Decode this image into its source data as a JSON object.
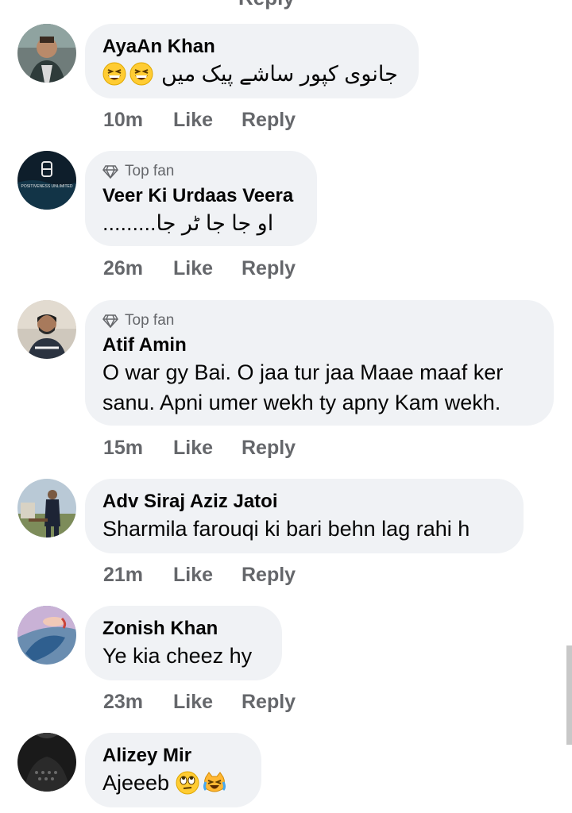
{
  "top_partial": {
    "text": "Reply"
  },
  "comments": [
    {
      "name": "AyaAn Khan",
      "text": "جانوی کپور ساشے پیک میں",
      "time": "10m",
      "like": "Like",
      "reply": "Reply"
    },
    {
      "badge": "Top fan",
      "name": "Veer Ki Urdaas Veera",
      "text": "او جا جا ٹر جا.........",
      "time": "26m",
      "like": "Like",
      "reply": "Reply",
      "avatar_text": "POSITIVENESS UNLIMITED"
    },
    {
      "badge": "Top fan",
      "name": "Atif Amin",
      "text": "O war gy Bai. O jaa tur jaa Maae maaf ker sanu. Apni umer wekh ty apny Kam wekh.",
      "time": "15m",
      "like": "Like",
      "reply": "Reply"
    },
    {
      "name": "Adv Siraj Aziz Jatoi",
      "text": "Sharmila farouqi ki bari behn lag rahi h",
      "time": "21m",
      "like": "Like",
      "reply": "Reply"
    },
    {
      "name": "Zonish Khan",
      "text": "Ye kia cheez hy",
      "time": "23m",
      "like": "Like",
      "reply": "Reply"
    },
    {
      "name": "Alizey Mir",
      "text": "Ajeeeb",
      "emoji": [
        "eye-roll-emoji",
        "crying-laughing-cat-emoji"
      ]
    }
  ],
  "colors": {
    "bubble": "#f0f2f5",
    "meta": "#65676b",
    "text": "#050505"
  }
}
